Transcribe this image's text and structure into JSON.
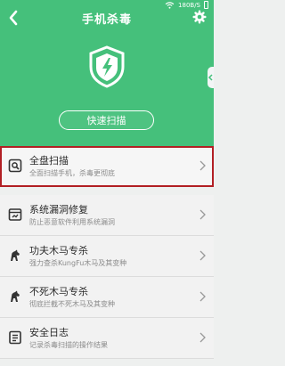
{
  "status": {
    "speed": "180B/S"
  },
  "header": {
    "title": "手机杀毒"
  },
  "hero": {
    "scan_button": "快速扫描"
  },
  "menu": [
    {
      "title": "全盘扫描",
      "subtitle": "全面扫描手机，杀毒更彻底"
    },
    {
      "title": "系统漏洞修复",
      "subtitle": "防止恶意软件利用系统漏洞"
    },
    {
      "title": "功夫木马专杀",
      "subtitle": "强力查杀KungFu木马及其变种"
    },
    {
      "title": "不死木马专杀",
      "subtitle": "彻底拦截不死木马及其变种"
    },
    {
      "title": "安全日志",
      "subtitle": "记录杀毒扫描的操作结果"
    }
  ],
  "colors": {
    "primary": "#45c07b",
    "highlight": "#b21f24"
  }
}
